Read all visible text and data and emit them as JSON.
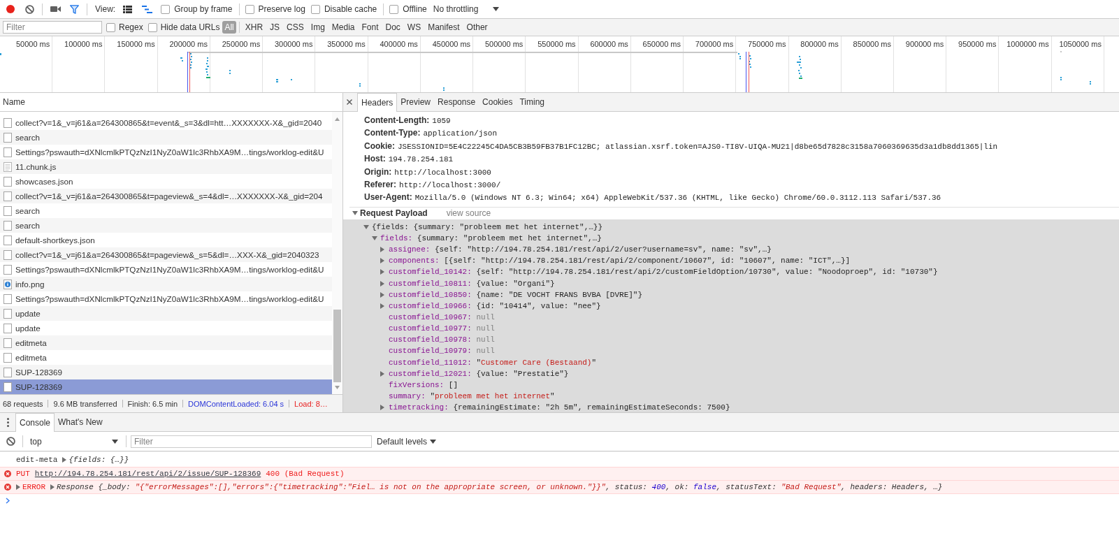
{
  "toolbar": {
    "recording": true,
    "filter_active": true,
    "view_label": "View:",
    "view_toggles": [
      {
        "kind": "large_rows",
        "on": false
      },
      {
        "kind": "overview",
        "on": true
      }
    ],
    "checkbox_groups": [
      [
        {
          "label": "Group by frame",
          "checked": false
        }
      ],
      [
        {
          "label": "Preserve log",
          "checked": false
        },
        {
          "label": "Disable cache",
          "checked": false
        }
      ],
      [
        {
          "label": "Offline",
          "checked": false
        }
      ]
    ],
    "throttling": "No throttling"
  },
  "filter_bar": {
    "filter": {
      "placeholder": "Filter"
    },
    "options": [
      {
        "label": "Regex",
        "checked": false
      },
      {
        "label": "Hide data URLs",
        "checked": false
      }
    ],
    "types": [
      {
        "label": "All",
        "selected": true
      },
      {
        "label": "XHR",
        "selected": false
      },
      {
        "label": "JS",
        "selected": false
      },
      {
        "label": "CSS",
        "selected": false
      },
      {
        "label": "Img",
        "selected": false
      },
      {
        "label": "Media",
        "selected": false
      },
      {
        "label": "Font",
        "selected": false
      },
      {
        "label": "Doc",
        "selected": false
      },
      {
        "label": "WS",
        "selected": false
      },
      {
        "label": "Manifest",
        "selected": false
      },
      {
        "label": "Other",
        "selected": false
      }
    ]
  },
  "timeline": {
    "ticks": [
      "50000 ms",
      "100000 ms",
      "150000 ms",
      "200000 ms",
      "250000 ms",
      "300000 ms",
      "350000 ms",
      "400000 ms",
      "450000 ms",
      "500000 ms",
      "550000 ms",
      "600000 ms",
      "650000 ms",
      "700000 ms",
      "750000 ms",
      "800000 ms",
      "850000 ms",
      "900000 ms",
      "950000 ms",
      "1000000 ms",
      "1050000 ms"
    ]
  },
  "requests": {
    "column": "Name",
    "rows": [
      {
        "name": "collect?v=1&_v=j61&a=264300865&t=event&_s=3&dl=htt…XXXXXXX-X&_gid=2040",
        "kind": "file",
        "selected": false
      },
      {
        "name": "search",
        "kind": "file",
        "selected": false
      },
      {
        "name": "Settings?pswauth=dXNlcmlkPTQzNzI1NyZ0aW1lc3RhbXA9M…tings/worklog-edit&U",
        "kind": "file",
        "selected": false
      },
      {
        "name": "11.chunk.js",
        "kind": "script",
        "selected": false
      },
      {
        "name": "showcases.json",
        "kind": "file",
        "selected": false
      },
      {
        "name": "collect?v=1&_v=j61&a=264300865&t=pageview&_s=4&dl=…XXXXXXX-X&_gid=204",
        "kind": "file",
        "selected": false
      },
      {
        "name": "search",
        "kind": "file",
        "selected": false
      },
      {
        "name": "search",
        "kind": "file",
        "selected": false
      },
      {
        "name": "default-shortkeys.json",
        "kind": "file",
        "selected": false
      },
      {
        "name": "collect?v=1&_v=j61&a=264300865&t=pageview&_s=5&dl=…XXX-X&_gid=2040323",
        "kind": "file",
        "selected": false
      },
      {
        "name": "Settings?pswauth=dXNlcmlkPTQzNzI1NyZ0aW1lc3RhbXA9M…tings/worklog-edit&U",
        "kind": "file",
        "selected": false
      },
      {
        "name": "info.png",
        "kind": "image",
        "selected": false
      },
      {
        "name": "Settings?pswauth=dXNlcmlkPTQzNzI1NyZ0aW1lc3RhbXA9M…tings/worklog-edit&U",
        "kind": "file",
        "selected": false
      },
      {
        "name": "update",
        "kind": "file",
        "selected": false
      },
      {
        "name": "update",
        "kind": "file",
        "selected": false
      },
      {
        "name": "editmeta",
        "kind": "file",
        "selected": false
      },
      {
        "name": "editmeta",
        "kind": "file",
        "selected": false
      },
      {
        "name": "SUP-128369",
        "kind": "file",
        "selected": false
      },
      {
        "name": "SUP-128369",
        "kind": "file",
        "selected": true
      }
    ]
  },
  "status_bar": [
    {
      "text": "68 requests",
      "color": "#333333"
    },
    {
      "text": "9.6 MB transferred",
      "color": "#333333"
    },
    {
      "text": "Finish: 6.5 min",
      "color": "#333333"
    },
    {
      "text": "DOMContentLoaded: 6.04 s",
      "color": "#2a35d8"
    },
    {
      "text": "Load: 8…",
      "color": "#e82020"
    }
  ],
  "details": {
    "tabs": [
      {
        "label": "Headers",
        "selected": true
      },
      {
        "label": "Preview",
        "selected": false
      },
      {
        "label": "Response",
        "selected": false
      },
      {
        "label": "Cookies",
        "selected": false
      },
      {
        "label": "Timing",
        "selected": false
      }
    ],
    "headers": [
      {
        "name": "Content-Length:",
        "value": "1059"
      },
      {
        "name": "Content-Type:",
        "value": "application/json"
      },
      {
        "name": "Cookie:",
        "value": "JSESSIONID=5E4C22245C4DA5CB3B59FB37B1FC12BC; atlassian.xsrf.token=AJS0-TI8V-UIQA-MU21|d8be65d7828c3158a7060369635d3a1db8dd1365|lin"
      },
      {
        "name": "Host:",
        "value": "194.78.254.181"
      },
      {
        "name": "Origin:",
        "value": "http://localhost:3000"
      },
      {
        "name": "Referer:",
        "value": "http://localhost:3000/"
      },
      {
        "name": "User-Agent:",
        "value": "Mozilla/5.0 (Windows NT 6.3; Win64; x64) AppleWebKit/537.36 (KHTML, like Gecko) Chrome/60.0.3112.113 Safari/537.36"
      }
    ],
    "payload": {
      "title": "Request Payload",
      "expanded": true,
      "view_source": "view source",
      "tree": [
        {
          "kind": "object",
          "expanded": true,
          "value": "{fields: {summary: \"probleem met het internet\",…}}",
          "children": [
            {
              "kind": "object",
              "key": "fields:",
              "expanded": true,
              "value": "{summary: \"probleem met het internet\",…}",
              "children": [
                {
                  "kind": "object",
                  "key": "assignee:",
                  "expanded": false,
                  "value": "{self: \"http://194.78.254.181/rest/api/2/user?username=sv\", name: \"sv\",…}"
                },
                {
                  "kind": "object",
                  "key": "components:",
                  "expanded": false,
                  "value": "[{self: \"http://194.78.254.181/rest/api/2/component/10607\", id: \"10607\", name: \"ICT\",…}]"
                },
                {
                  "kind": "object",
                  "key": "customfield_10142:",
                  "expanded": false,
                  "value": "{self: \"http://194.78.254.181/rest/api/2/customFieldOption/10730\", value: \"Noodoproep\", id: \"10730\"}"
                },
                {
                  "kind": "object",
                  "key": "customfield_10811:",
                  "expanded": false,
                  "value": "{value: \"Organi\"}"
                },
                {
                  "kind": "object",
                  "key": "customfield_10850:",
                  "expanded": false,
                  "value": "{name: \"DE VOCHT FRANS BVBA [DVRE]\"}"
                },
                {
                  "kind": "object",
                  "key": "customfield_10966:",
                  "expanded": false,
                  "value": "{id: \"10414\", value: \"nee\"}"
                },
                {
                  "kind": "null",
                  "key": "customfield_10967:",
                  "value": "null"
                },
                {
                  "kind": "null",
                  "key": "customfield_10977:",
                  "value": "null"
                },
                {
                  "kind": "null",
                  "key": "customfield_10978:",
                  "value": "null"
                },
                {
                  "kind": "null",
                  "key": "customfield_10979:",
                  "value": "null"
                },
                {
                  "kind": "string",
                  "key": "customfield_11012:",
                  "value": "\"Customer Care (Bestaand)\""
                },
                {
                  "kind": "object",
                  "key": "customfield_12021:",
                  "expanded": false,
                  "value": "{value: \"Prestatie\"}"
                },
                {
                  "kind": "plain",
                  "key": "fixVersions:",
                  "value": "[]"
                },
                {
                  "kind": "string",
                  "key": "summary:",
                  "value": "\"probleem met het internet\""
                },
                {
                  "kind": "object",
                  "key": "timetracking:",
                  "expanded": false,
                  "value": "{remainingEstimate: \"2h 5m\", remainingEstimateSeconds: 7500}"
                }
              ]
            }
          ]
        }
      ]
    }
  },
  "console": {
    "tabs": [
      {
        "label": "Console",
        "selected": true
      },
      {
        "label": "What's New",
        "selected": false
      }
    ],
    "context": "top",
    "filter": {
      "placeholder": "Filter"
    },
    "levels": "Default levels",
    "messages": [
      {
        "kind": "log",
        "parts": [
          {
            "kind": "text",
            "text": "edit-meta"
          },
          {
            "kind": "object",
            "expanded": false,
            "segments": [
              {
                "kind": "plain",
                "text": "{fields: {…}}"
              }
            ]
          }
        ]
      },
      {
        "kind": "error",
        "parts": [
          {
            "kind": "text",
            "text": "PUT"
          },
          {
            "kind": "link",
            "text": "http://194.78.254.181/rest/api/2/issue/SUP-128369"
          },
          {
            "kind": "text",
            "text": "400 (Bad Request)"
          }
        ]
      },
      {
        "kind": "error",
        "parts": [
          {
            "kind": "group",
            "expanded": false,
            "text": "ERROR"
          },
          {
            "kind": "object",
            "expanded": false,
            "segments": [
              {
                "kind": "plain",
                "text": "Response {_body: "
              },
              {
                "kind": "string",
                "text": "\"{\"errorMessages\":[],\"errors\":{\"timetracking\":\"Fiel… is not on the appropriate screen, or unknown.\"}}\""
              },
              {
                "kind": "plain",
                "text": ", status: "
              },
              {
                "kind": "number",
                "text": "400"
              },
              {
                "kind": "plain",
                "text": ", ok: "
              },
              {
                "kind": "boolean",
                "text": "false"
              },
              {
                "kind": "plain",
                "text": ", statusText: "
              },
              {
                "kind": "string",
                "text": "\"Bad Request\""
              },
              {
                "kind": "plain",
                "text": ", headers: Headers, …}"
              }
            ]
          }
        ]
      }
    ]
  }
}
